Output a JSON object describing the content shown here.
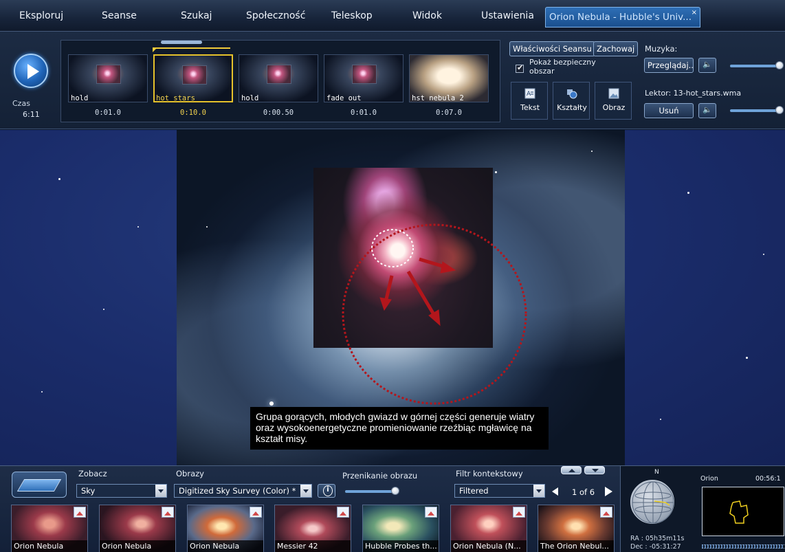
{
  "menu": {
    "items": [
      "Eksploruj",
      "Seanse",
      "Szukaj",
      "Społeczność",
      "Teleskop",
      "Widok",
      "Ustawienia"
    ],
    "active_tab": "Orion Nebula - Hubble's Univ...",
    "close_glyph": "×"
  },
  "editor": {
    "time_label": "Czas",
    "time_value": "6:11",
    "slides": [
      {
        "label": "hold",
        "time": "0:01.0"
      },
      {
        "label": "hot stars",
        "time": "0:10.0"
      },
      {
        "label": "hold",
        "time": "0:00.50"
      },
      {
        "label": "fade out",
        "time": "0:01.0"
      },
      {
        "label": "hst nebula 2",
        "time": "0:07.0"
      }
    ],
    "properties_button": "Właściwości Seansu",
    "save_button": "Zachowaj",
    "safe_area_label": "Pokaż bezpieczny obszar",
    "tools": {
      "text": "Tekst",
      "shapes": "Kształty",
      "image": "Obraz"
    },
    "music_label": "Muzyka:",
    "browse_button": "Przeglądaj...",
    "narrator_label": "Lektor: 13-hot_stars.wma",
    "remove_button": "Usuń"
  },
  "sky": {
    "caption": "Grupa gorących, młodych gwiazd w górnej części generuje wiatry oraz wysokoenergetyczne promieniowanie rzeźbiąc mgławicę na kształt misy."
  },
  "bottom": {
    "look_label": "Zobacz",
    "look_value": "Sky",
    "images_label": "Obrazy",
    "images_value": "Digitized Sky Survey (Color) *",
    "crossfade_label": "Przenikanie obrazu",
    "filter_label": "Filtr kontekstowy",
    "filter_value": "Filtered",
    "page_indicator": "1 of 6",
    "results": [
      "Orion Nebula",
      "Orion Nebula",
      "Orion Nebula",
      "Messier 42",
      "Hubble Probes th...",
      "Orion Nebula (N...",
      "The Orion Nebul..."
    ],
    "compass_n": "N",
    "ra": "RA :  05h35m11s",
    "dec": "Dec :  -05:31:27",
    "constellation": "Orion",
    "clock": "00:56:1"
  }
}
